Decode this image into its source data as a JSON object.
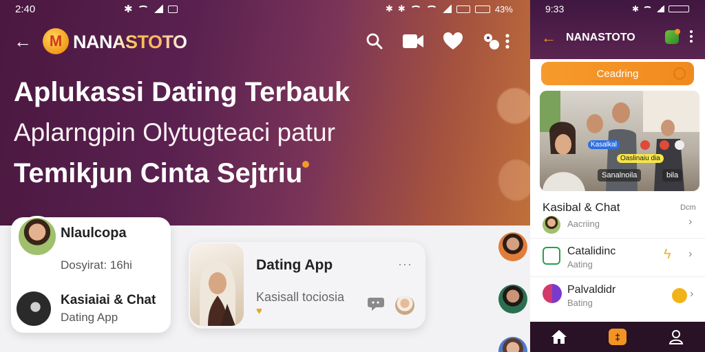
{
  "main": {
    "status": {
      "time": "2:40",
      "battery_text": "43%"
    },
    "appbar": {
      "brand": "NANASTOTO",
      "icons": [
        "back-arrow-icon",
        "search-icon",
        "video-icon",
        "heart-icon",
        "gift-icon",
        "more-vert-icon"
      ]
    },
    "hero": {
      "line1": "Aplukassi Dating Terbauk",
      "line2": "Aplarngpin Olytugteaci patur",
      "line3": "Temikjun Cinta Sejtriu"
    },
    "profile_card": {
      "name": "Nlaulcopa",
      "subtitle": "Dosyirat: 16hi",
      "item_title": "Kasiaiai & Chat",
      "item_subtitle": "Dating App"
    },
    "dating_card": {
      "title": "Dating App",
      "subtitle": "Kasisall tociosia",
      "more": "···"
    }
  },
  "phone": {
    "status": {
      "time": "9:33"
    },
    "appbar": {
      "brand": "NANASTOTO"
    },
    "cta": {
      "label": "Ceadring"
    },
    "photo_tags": {
      "tag1": "Kasalkal",
      "tag2": "Oaslinaiu dia",
      "chip1": "Sanalnoila",
      "chip2": "bila"
    },
    "section": {
      "title": "Kasibal & Chat",
      "aside": "Dcm"
    },
    "rows": [
      {
        "title": "",
        "subtitle": "Aacriing"
      },
      {
        "title": "Catalidinc",
        "subtitle": "Aating"
      },
      {
        "title": "Palvaldidr",
        "subtitle": "Bating"
      }
    ],
    "nav": [
      "home-icon",
      "chat-icon",
      "profile-icon"
    ]
  },
  "colors": {
    "accent": "#f29324",
    "hero_dark": "#4a1840",
    "hero_warm": "#c0703a"
  }
}
